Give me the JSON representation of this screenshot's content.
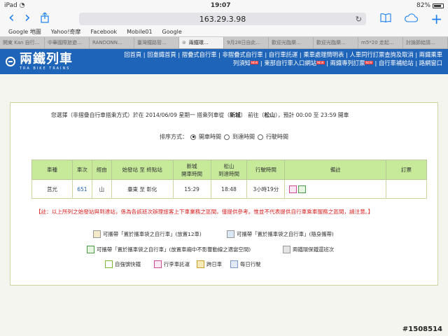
{
  "status": {
    "device": "iPad",
    "wifi": "◔",
    "time": "19:07",
    "battery": "82%"
  },
  "toolbar": {
    "back": "‹",
    "forward": "›",
    "url": "163.29.3.98",
    "reload": "↻",
    "add": "+"
  },
  "bookmarks": [
    "Google 地圖",
    "Yahoo!奇摩",
    "Facebook",
    "Mobile01",
    "Google"
  ],
  "tabs": [
    {
      "label": "開東 Kan 自行...",
      "active": false
    },
    {
      "label": "中華國際旅遊...",
      "active": false
    },
    {
      "label": "RANDONN...",
      "active": false
    },
    {
      "label": "臺灣鐵路管...",
      "active": false
    },
    {
      "label": "兩鐵環...",
      "active": true
    },
    {
      "label": "9月28日自此...",
      "active": false
    },
    {
      "label": "歡迎光臨樂...",
      "active": false
    },
    {
      "label": "歡迎光臨樂...",
      "active": false
    },
    {
      "label": "m5*20 走起...",
      "active": false
    },
    {
      "label": "討論節給請...",
      "active": false
    }
  ],
  "banner": {
    "logo": "兩鐵列車",
    "logo_sub": "TRA  BIKE  TRAINS",
    "menu_line1": "回首頁 | 回臺鐵首頁 | 摺疊式自行車 | 非摺疊式自行車 | 自行車託運 | 乘車處理簡明表 | 人車同行訂票查詢及取消 | 兩鐵乘車",
    "menu_line2a": "列須知",
    "menu_line2b": " | 東部自行車入口網站",
    "menu_line2c": " | 兩鐵專列訂票",
    "menu_line2d": " | 自行車補給站 | 路網窗口",
    "new_badge": "NEW"
  },
  "info": {
    "prefix": "您選擇（非摺疊自行車搭乘方式）於在  2014/06/09  星期一  搭乘列車從（",
    "from": "新城",
    "mid": "）  前往（",
    "to": "松山",
    "suffix": "），預計  00:00  至  23:59  開車"
  },
  "sort": {
    "label": "排序方式：",
    "options": [
      "開車時間",
      "到達時間",
      "行駛時間"
    ]
  },
  "table": {
    "headers": [
      "車種",
      "車次",
      "經由",
      "始發站 至 終點站",
      "新城\n開車時間",
      "松山\n到達時間",
      "行駛時間",
      "備註",
      "訂票"
    ],
    "row": {
      "type": "莒光",
      "train": "651",
      "via": "山",
      "route": "臺東 至 彰化",
      "dep": "15:29",
      "arr": "18:48",
      "duration": "3小時19分"
    }
  },
  "note": "【註：以上所列之始發站與到達站，係為各該班次辦理旅客上下車業務之區間，僅提供參考。惟並不代表提供自行車乘車服務之區間，請注意。】",
  "legend": [
    "可攜帶「置於攜車袋之自行車」(放置12車)",
    "可攜帶「置於攜車袋之自行車」(隨身攜帶)",
    "可攜帶「置於攜車袋之自行車」(放置車廂中不影響動線之適當空間)",
    "兩鐵環保鐵還班次",
    "自強號快鐵",
    "行李車託運",
    "跨日車",
    "每日行駛"
  ],
  "watermark": "#1508514",
  "colors": {
    "banner": "#1e64b8",
    "header": "#c6ea9a",
    "note": "#d82020",
    "link": "#1e5fb0"
  }
}
